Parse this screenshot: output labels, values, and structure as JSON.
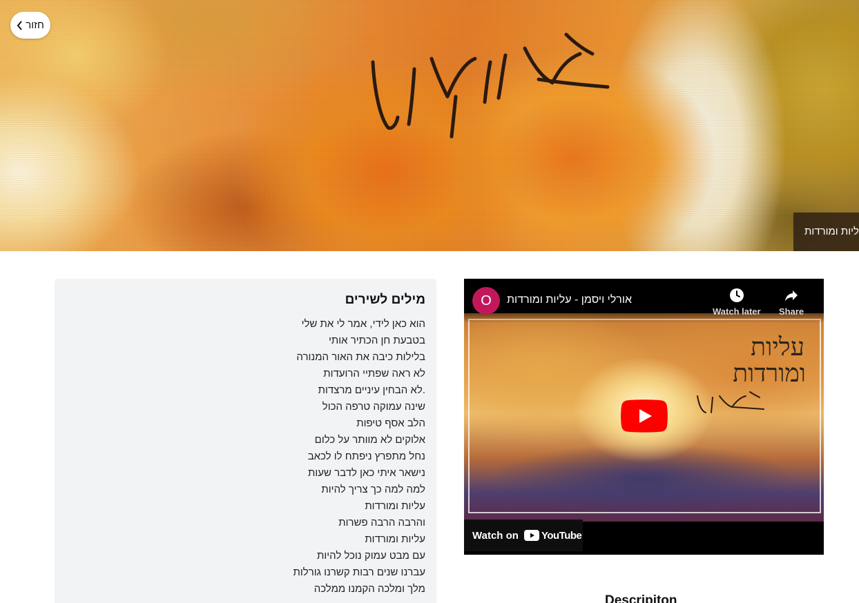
{
  "header": {
    "back_label": "חזור",
    "hero_caption": "עליות ומורדות",
    "hero_signature_text": "אורלי וייסמן"
  },
  "lyrics": {
    "title": "מילים לשירים",
    "lines": [
      "הוא כאן לידי, אמר לי את שלי",
      "בטבעת חן הכתיר אותי",
      "בלילות כיבה את האור המנורה",
      "לא ראה שפתיי הרועדות",
      ".לא הבחין עיניים מרצדות",
      "שינה עמוקה טרפה הכול",
      "הלב אסף טיפות",
      "אלוקים לא מוותר על כלום",
      "נחל מתפרץ ניפתח לו לכאב",
      "נישאר איתי כאן לדבר שעות",
      "למה למה כך צריך להיות",
      "עליות ומורדות",
      "והרבה הרבה פשרות",
      "עליות ומורדות",
      "עם מבט עמוק נוכל להיות",
      "עברנו שנים רבות קשרנו גורלות",
      "מלך ומלכה הקמנו ממלכה"
    ]
  },
  "video": {
    "channel_initial": "O",
    "title": "אורלי ויסמן - עליות ומורדות",
    "watch_later_label": "Watch later",
    "share_label": "Share",
    "thumbnail_title_line1": "עליות",
    "thumbnail_title_line2": "ומורדות",
    "thumbnail_signature_text": "אורלי וייסמן",
    "watch_on_label": "Watch on",
    "youtube_wordmark": "YouTube",
    "icons": [
      "clock-icon",
      "share-icon",
      "play-icon",
      "youtube-logo-icon"
    ],
    "colors": {
      "avatar": "#c2185b",
      "play": "#ff0000"
    }
  },
  "description": {
    "heading": "Descripiton"
  }
}
